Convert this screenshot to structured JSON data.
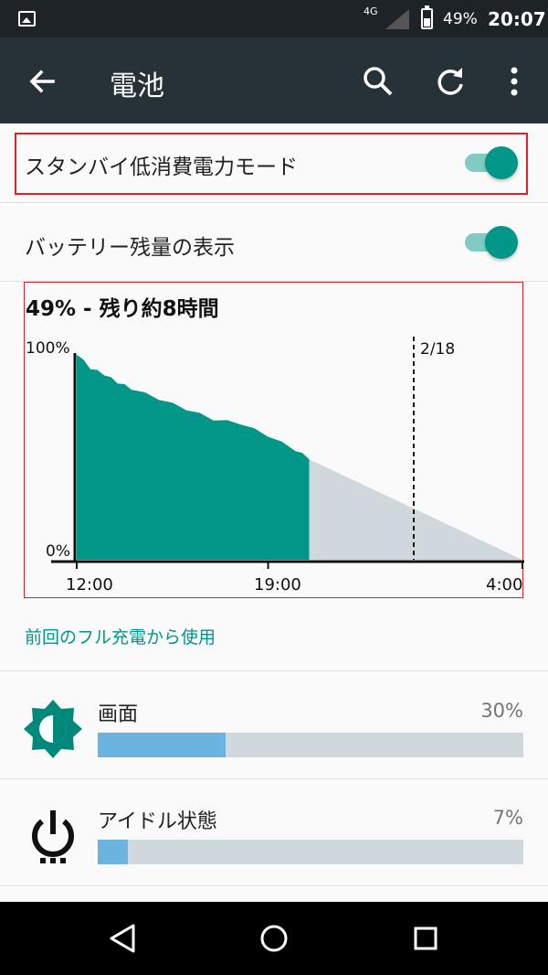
{
  "status_bar": {
    "network": "4G",
    "battery_percent": "49%",
    "time": "20:07"
  },
  "app_bar": {
    "title": "電池",
    "icons": [
      "arrow-back-icon",
      "search-icon",
      "refresh-icon",
      "more-vert-icon"
    ]
  },
  "settings": {
    "standby": {
      "label": "スタンバイ低消費電力モード",
      "enabled": true
    },
    "show_percentage": {
      "label": "バッテリー残量の表示",
      "enabled": true
    }
  },
  "battery_chart": {
    "title": "49% - 残り約8時間",
    "y_top_label": "100%",
    "y_bottom_label": "0%",
    "x_labels": [
      "12:00",
      "19:00",
      "4:00"
    ],
    "day_marker": "2/18"
  },
  "chart_data": {
    "type": "area",
    "title": "49% - 残り約8時間",
    "xlabel": "",
    "ylabel": "",
    "ylim": [
      0,
      100
    ],
    "x_ticks": [
      "12:00",
      "19:00",
      "4:00"
    ],
    "series": [
      {
        "x_hours_from_start": [
          0,
          0.5,
          1,
          1.5,
          2,
          3,
          4,
          5,
          6,
          7,
          8,
          8.5
        ],
        "values": [
          100,
          93,
          90,
          86,
          83,
          78,
          73,
          68,
          66,
          60,
          53,
          49
        ]
      },
      {
        "x_hours_from_start": [
          8.5,
          16.3
        ],
        "values": [
          49,
          0
        ]
      }
    ],
    "colors": {
      "used": "#009688",
      "projected": "#cfd8dc"
    },
    "marker_label": "2/18"
  },
  "usage": {
    "section_label": "前回のフル充電から使用",
    "items": [
      {
        "name": "画面",
        "percent": "30%",
        "fraction": 0.3,
        "icon": "brightness-icon"
      },
      {
        "name": "アイドル状態",
        "percent": "7%",
        "fraction": 0.07,
        "icon": "power-icon"
      }
    ]
  },
  "nav_bar": {
    "icons": [
      "back-nav-icon",
      "home-nav-icon",
      "recents-nav-icon"
    ]
  },
  "colors": {
    "accent": "#009688",
    "usage_bar": "#6cb4e0",
    "app_bar": "#263238"
  }
}
